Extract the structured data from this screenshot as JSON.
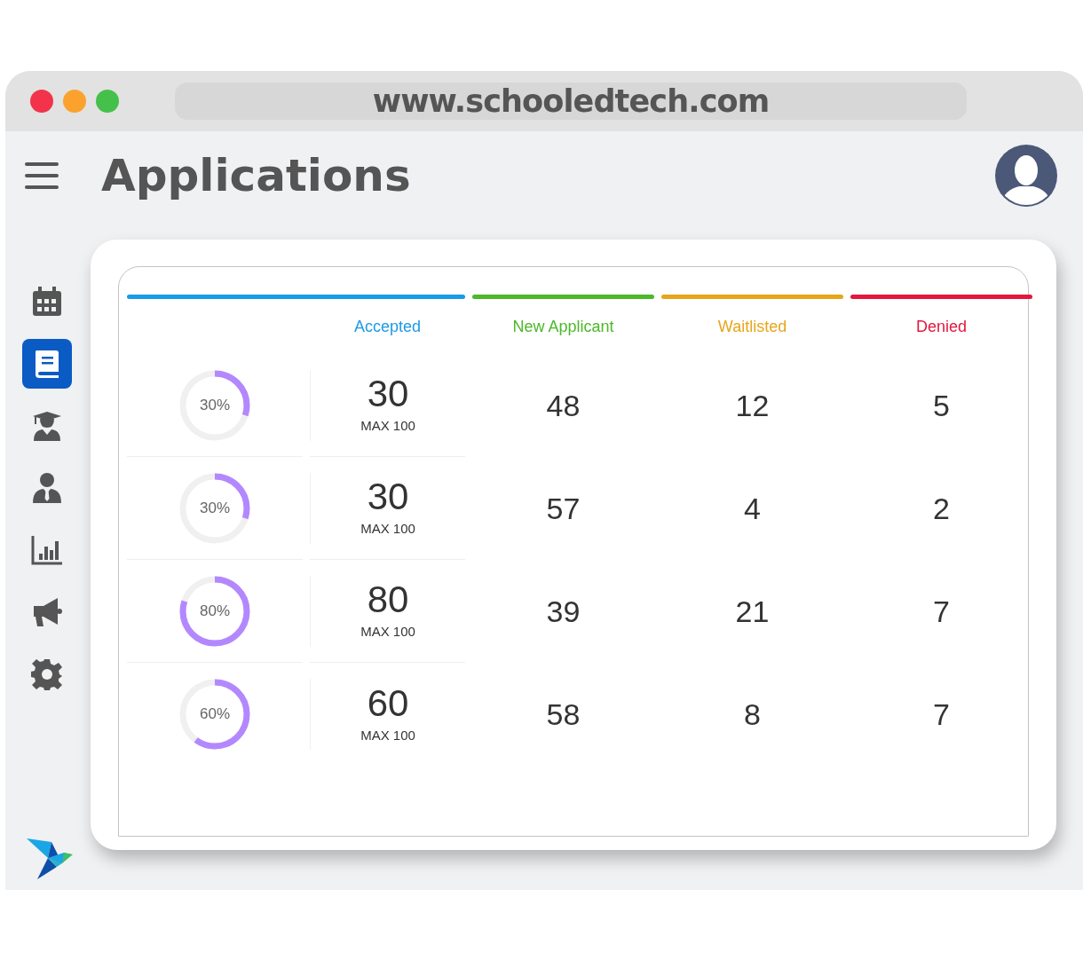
{
  "browser": {
    "url": "www.schooledtech.com"
  },
  "header": {
    "title": "Applications"
  },
  "sidebar": {
    "items": [
      {
        "kind": "calendar",
        "selected": false
      },
      {
        "kind": "book",
        "selected": true
      },
      {
        "kind": "graduate",
        "selected": false
      },
      {
        "kind": "person",
        "selected": false
      },
      {
        "kind": "chart",
        "selected": false
      },
      {
        "kind": "megaphone",
        "selected": false
      },
      {
        "kind": "gear",
        "selected": false
      }
    ]
  },
  "table": {
    "columns": [
      {
        "label": "Accepted",
        "color": "#1a9be6"
      },
      {
        "label": "New Applicant",
        "color": "#4cb82a"
      },
      {
        "label": "Waitlisted",
        "color": "#e6a619"
      },
      {
        "label": "Denied",
        "color": "#e3173e"
      }
    ],
    "rows": [
      {
        "percent": "30%",
        "level": 0.3,
        "accepted": "30",
        "max": "MAX 100",
        "new_applicant": "48",
        "waitlisted": "12",
        "denied": "5"
      },
      {
        "percent": "30%",
        "level": 0.3,
        "accepted": "30",
        "max": "MAX 100",
        "new_applicant": "57",
        "waitlisted": "4",
        "denied": "2"
      },
      {
        "percent": "80%",
        "level": 0.8,
        "accepted": "80",
        "max": "MAX 100",
        "new_applicant": "39",
        "waitlisted": "21",
        "denied": "7"
      },
      {
        "percent": "60%",
        "level": 0.6,
        "accepted": "60",
        "max": "MAX 100",
        "new_applicant": "58",
        "waitlisted": "8",
        "denied": "7"
      }
    ]
  }
}
